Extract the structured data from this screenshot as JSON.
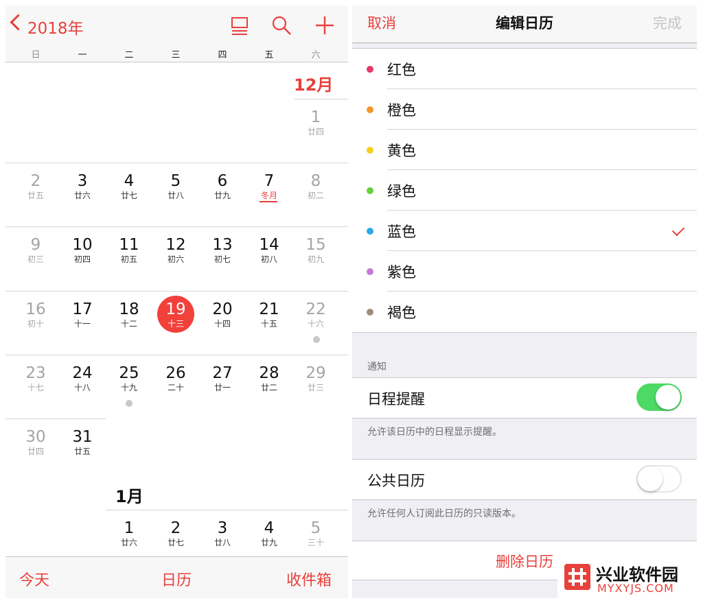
{
  "calendar": {
    "back_label": "2018年",
    "weekdays": [
      "日",
      "一",
      "二",
      "三",
      "四",
      "五",
      "六"
    ],
    "dec_label": "12月",
    "jan_label": "1月",
    "dec_days": [
      {
        "num": "1",
        "lunar": "廿四"
      },
      {
        "num": "2",
        "lunar": "廿五"
      },
      {
        "num": "3",
        "lunar": "廿六"
      },
      {
        "num": "4",
        "lunar": "廿七"
      },
      {
        "num": "5",
        "lunar": "廿八"
      },
      {
        "num": "6",
        "lunar": "廿九"
      },
      {
        "num": "7",
        "lunar": "冬月"
      },
      {
        "num": "8",
        "lunar": "初二"
      },
      {
        "num": "9",
        "lunar": "初三"
      },
      {
        "num": "10",
        "lunar": "初四"
      },
      {
        "num": "11",
        "lunar": "初五"
      },
      {
        "num": "12",
        "lunar": "初六"
      },
      {
        "num": "13",
        "lunar": "初七"
      },
      {
        "num": "14",
        "lunar": "初八"
      },
      {
        "num": "15",
        "lunar": "初九"
      },
      {
        "num": "16",
        "lunar": "初十"
      },
      {
        "num": "17",
        "lunar": "十一"
      },
      {
        "num": "18",
        "lunar": "十二"
      },
      {
        "num": "19",
        "lunar": "十三"
      },
      {
        "num": "20",
        "lunar": "十四"
      },
      {
        "num": "21",
        "lunar": "十五"
      },
      {
        "num": "22",
        "lunar": "十六"
      },
      {
        "num": "23",
        "lunar": "十七"
      },
      {
        "num": "24",
        "lunar": "十八"
      },
      {
        "num": "25",
        "lunar": "十九"
      },
      {
        "num": "26",
        "lunar": "二十"
      },
      {
        "num": "27",
        "lunar": "廿一"
      },
      {
        "num": "28",
        "lunar": "廿二"
      },
      {
        "num": "29",
        "lunar": "廿三"
      },
      {
        "num": "30",
        "lunar": "廿四"
      },
      {
        "num": "31",
        "lunar": "廿五"
      }
    ],
    "jan_days": [
      {
        "num": "1",
        "lunar": "廿六"
      },
      {
        "num": "2",
        "lunar": "廿七"
      },
      {
        "num": "3",
        "lunar": "廿八"
      },
      {
        "num": "4",
        "lunar": "廿九"
      },
      {
        "num": "5",
        "lunar": "三十"
      }
    ],
    "tabs": {
      "today": "今天",
      "calendars": "日历",
      "inbox": "收件箱"
    }
  },
  "edit": {
    "cancel": "取消",
    "title": "编辑日历",
    "done": "完成",
    "colors": [
      {
        "label": "红色",
        "color": "#e8366b"
      },
      {
        "label": "橙色",
        "color": "#f5962f"
      },
      {
        "label": "黄色",
        "color": "#f7cd1c"
      },
      {
        "label": "绿色",
        "color": "#63d43c"
      },
      {
        "label": "蓝色",
        "color": "#2aa9e9"
      },
      {
        "label": "紫色",
        "color": "#c47ad7"
      },
      {
        "label": "褐色",
        "color": "#a28b73"
      }
    ],
    "selected_color": "蓝色",
    "notify_header": "通知",
    "event_alerts": {
      "label": "日程提醒",
      "on": true,
      "footer": "允许该日历中的日程显示提醒。"
    },
    "public_calendar": {
      "label": "公共日历",
      "on": false,
      "footer": "允许任何人订阅此日历的只读版本。"
    },
    "delete_label": "删除日历"
  },
  "watermark": {
    "title": "兴业软件园",
    "url": "MYXYJS.COM"
  }
}
